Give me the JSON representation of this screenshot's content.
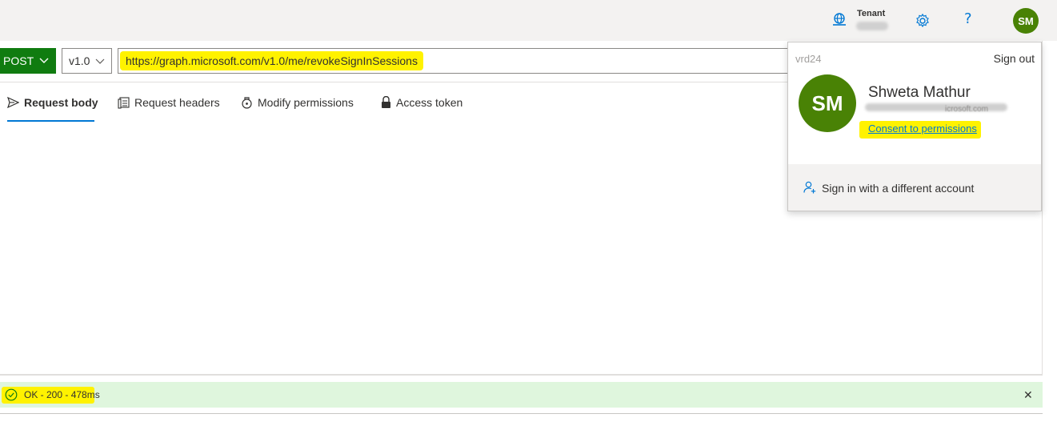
{
  "header": {
    "tenant_label": "Tenant",
    "avatar_initials": "SM"
  },
  "request": {
    "method": "POST",
    "version": "v1.0",
    "url": "https://graph.microsoft.com/v1.0/me/revokeSignInSessions"
  },
  "tabs": [
    {
      "label": "Request body",
      "icon": "send-icon",
      "active": true
    },
    {
      "label": "Request headers",
      "icon": "headers-icon",
      "active": false
    },
    {
      "label": "Modify permissions",
      "icon": "permissions-icon",
      "active": false
    },
    {
      "label": "Access token",
      "icon": "lock-icon",
      "active": false
    }
  ],
  "status": {
    "text": "OK - 200 - 478ms",
    "close": "✕"
  },
  "account_flyout": {
    "org": "vrd24",
    "sign_out": "Sign out",
    "avatar_initials": "SM",
    "user_name": "Shweta Mathur",
    "email_tail": "icrosoft.com",
    "consent_link": "Consent to permissions",
    "different_account": "Sign in with a different account"
  },
  "colors": {
    "method_green": "#107c10",
    "avatar_green": "#498205",
    "accent_blue": "#0078d4",
    "highlight_yellow": "#fff200",
    "success_bg": "#dff6dd"
  }
}
